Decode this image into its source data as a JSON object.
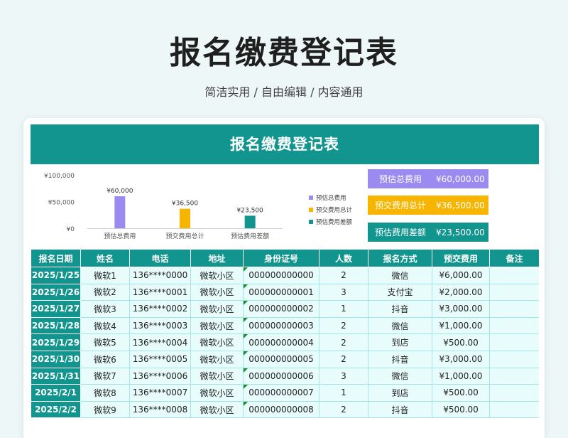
{
  "page": {
    "title": "报名缴费登记表",
    "subtitle": "简洁实用 / 自由编辑 / 内容通用"
  },
  "sheet": {
    "title": "报名缴费登记表"
  },
  "stats": [
    {
      "label": "预估总费用",
      "value": "¥60,000.00",
      "color": "#9b8af0"
    },
    {
      "label": "预交费用总计",
      "value": "¥36,500.00",
      "color": "#f7b500"
    },
    {
      "label": "预估费用差额",
      "value": "¥23,500.00",
      "color": "#12958f"
    }
  ],
  "chart_data": {
    "type": "bar",
    "categories": [
      "预估总费用",
      "预交费用总计",
      "预估费用差额"
    ],
    "values": [
      60000,
      36500,
      23500
    ],
    "value_labels": [
      "¥60,000",
      "¥36,500",
      "¥23,500"
    ],
    "colors": [
      "#9b8af0",
      "#f7b500",
      "#12958f"
    ],
    "y_ticks": [
      0,
      50000,
      100000
    ],
    "y_tick_labels": [
      "¥0",
      "¥50,000",
      "¥100,000"
    ],
    "ylim": [
      0,
      100000
    ],
    "legend": [
      "预估总费用",
      "预交费用总计",
      "预估费用差额"
    ],
    "legend_position": "right",
    "grid": false
  },
  "table": {
    "headers": [
      "报名日期",
      "姓名",
      "电话",
      "地址",
      "身份证号",
      "人数",
      "报名方式",
      "预交费用",
      "备注"
    ],
    "rows": [
      [
        "2025/1/25",
        "微软1",
        "136****0000",
        "微软小区",
        "000000000000",
        "2",
        "微信",
        "¥6,000.00",
        ""
      ],
      [
        "2025/1/26",
        "微软2",
        "136****0001",
        "微软小区",
        "000000000001",
        "3",
        "支付宝",
        "¥2,000.00",
        ""
      ],
      [
        "2025/1/27",
        "微软3",
        "136****0002",
        "微软小区",
        "000000000002",
        "1",
        "抖音",
        "¥3,000.00",
        ""
      ],
      [
        "2025/1/28",
        "微软4",
        "136****0003",
        "微软小区",
        "000000000003",
        "2",
        "微信",
        "¥1,000.00",
        ""
      ],
      [
        "2025/1/29",
        "微软5",
        "136****0004",
        "微软小区",
        "000000000004",
        "2",
        "到店",
        "¥500.00",
        ""
      ],
      [
        "2025/1/30",
        "微软6",
        "136****0005",
        "微软小区",
        "000000000005",
        "2",
        "抖音",
        "¥3,000.00",
        ""
      ],
      [
        "2025/1/31",
        "微软7",
        "136****0006",
        "微软小区",
        "000000000006",
        "3",
        "微信",
        "¥1,000.00",
        ""
      ],
      [
        "2025/2/1",
        "微软8",
        "136****0007",
        "微软小区",
        "000000000007",
        "1",
        "到店",
        "¥500.00",
        ""
      ],
      [
        "2025/2/2",
        "微软9",
        "136****0008",
        "微软小区",
        "000000000008",
        "2",
        "抖音",
        "¥500.00",
        ""
      ]
    ]
  }
}
